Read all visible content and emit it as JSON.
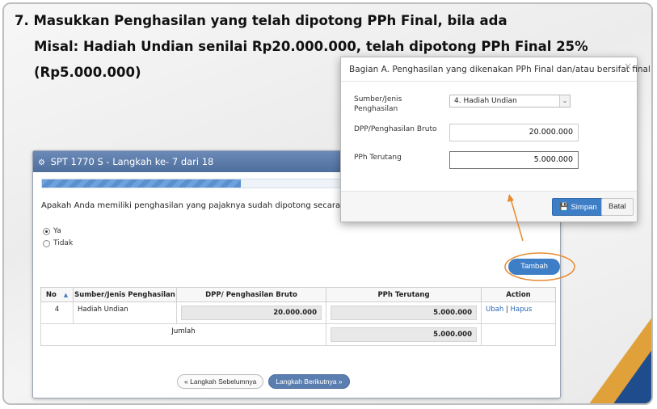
{
  "heading": {
    "line1": "7. Masukkan Penghasilan yang telah dipotong PPh Final, bila ada",
    "line2": "Misal: Hadiah Undian senilai Rp20.000.000, telah dipotong PPh Final 25%",
    "line3": "(Rp5.000.000)"
  },
  "window": {
    "title": "SPT 1770 S - Langkah ke- 7 dari 18",
    "progress_fraction": 0.39,
    "question": "Apakah Anda memiliki penghasilan yang pajaknya sudah dipotong secara fin",
    "options": [
      {
        "label": "Ya",
        "selected": true
      },
      {
        "label": "Tidak",
        "selected": false
      }
    ],
    "add_button": "Tambah ✚"
  },
  "table": {
    "headers": {
      "no": "No",
      "sort_icon": "▲",
      "jenis": "Sumber/Jenis Penghasilan",
      "dpp": "DPP/ Penghasilan Bruto",
      "pph": "PPh Terutang",
      "action": "Action"
    },
    "rows": [
      {
        "no": "4",
        "jenis": "Hadiah Undian",
        "dpp": "20.000.000",
        "pph": "5.000.000",
        "ubah": "Ubah",
        "sep": " | ",
        "hapus": "Hapus"
      }
    ],
    "total_label": "Jumlah",
    "total_value": "5.000.000"
  },
  "nav": {
    "prev": "« Langkah Sebelumnya",
    "next": "Langkah Berikutnya »"
  },
  "modal": {
    "title": "Bagian A. Penghasilan yang dikenakan PPh Final dan/atau bersifat final",
    "close": "×",
    "field_jenis_label": "Sumber/Jenis Penghasilan",
    "field_jenis_value": "4. Hadiah Undian",
    "field_dpp_label": "DPP/Penghasilan Bruto",
    "field_dpp_value": "20.000.000",
    "field_pph_label": "PPh Terutang",
    "field_pph_value": "5.000.000",
    "save": "💾 Simpan",
    "cancel": "Batal"
  },
  "colors": {
    "accent": "#3d7ec7",
    "annotation": "#e8892c",
    "titlebar": "#5b7eb0"
  }
}
